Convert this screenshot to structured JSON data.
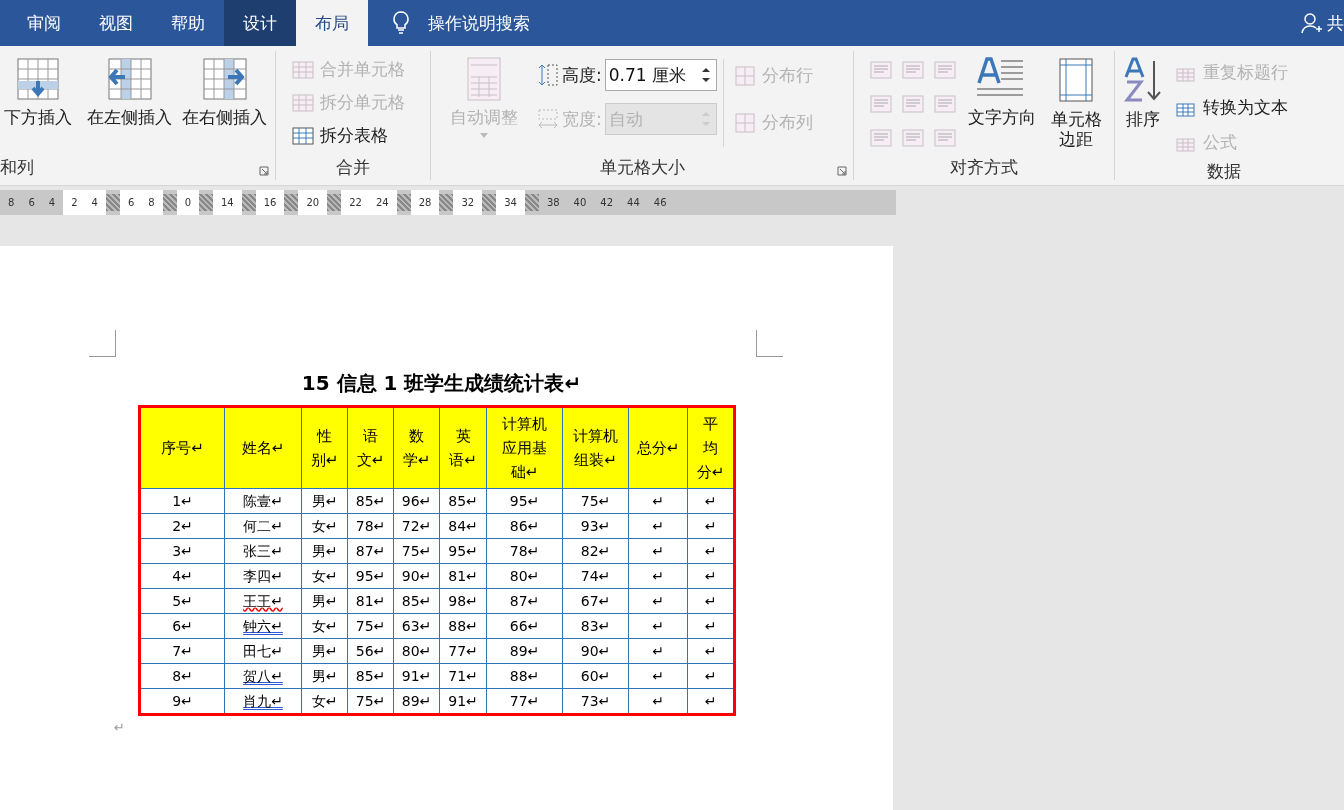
{
  "tabs": [
    {
      "label": "审阅",
      "selected": false,
      "contextual": false
    },
    {
      "label": "视图",
      "selected": false,
      "contextual": false
    },
    {
      "label": "帮助",
      "selected": false,
      "contextual": false
    },
    {
      "label": "设计",
      "selected": false,
      "contextual": true
    },
    {
      "label": "布局",
      "selected": true,
      "contextual": true
    }
  ],
  "search": {
    "label": "操作说明搜索"
  },
  "share": {
    "label": "共"
  },
  "ribbon": {
    "groups": [
      {
        "label": "和列",
        "items": [
          {
            "label": "下方插入",
            "disabled": false
          },
          {
            "label": "在左侧插入",
            "disabled": false
          },
          {
            "label": "在右侧插入",
            "disabled": false
          }
        ]
      },
      {
        "label": "合并",
        "items": [
          {
            "label": "合并单元格",
            "disabled": true
          },
          {
            "label": "拆分单元格",
            "disabled": true
          },
          {
            "label": "拆分表格",
            "disabled": false
          }
        ]
      },
      {
        "label": "单元格大小",
        "items": [
          {
            "label": "自动调整",
            "disabled": true
          },
          {
            "label": "高度:",
            "value": "0.71 厘米",
            "disabled": false
          },
          {
            "label": "宽度:",
            "value": "自动",
            "disabled": true
          },
          {
            "label": "分布行",
            "disabled": true
          },
          {
            "label": "分布列",
            "disabled": true
          }
        ]
      },
      {
        "label": "对齐方式",
        "items": [
          {
            "label": "文字方向",
            "disabled": false
          },
          {
            "label": "单元格边距",
            "disabled": false
          }
        ]
      },
      {
        "label": "数据",
        "items": [
          {
            "label": "排序",
            "disabled": false
          },
          {
            "label": "重复标题行",
            "disabled": true
          },
          {
            "label": "转换为文本",
            "disabled": false
          },
          {
            "label": "公式",
            "disabled": true
          }
        ]
      }
    ]
  },
  "ruler": [
    {
      "kind": "plain",
      "labels": [
        "8",
        "6",
        "4"
      ]
    },
    {
      "kind": "cell",
      "labels": [
        "2",
        "4"
      ]
    },
    {
      "kind": "marker"
    },
    {
      "kind": "cell",
      "labels": [
        "6",
        "8"
      ]
    },
    {
      "kind": "marker"
    },
    {
      "kind": "cell",
      "labels": [
        "0"
      ]
    },
    {
      "kind": "marker"
    },
    {
      "kind": "cell",
      "labels": [
        "14"
      ]
    },
    {
      "kind": "marker"
    },
    {
      "kind": "cell",
      "labels": [
        "16"
      ]
    },
    {
      "kind": "marker"
    },
    {
      "kind": "cell",
      "labels": [
        "20"
      ]
    },
    {
      "kind": "marker"
    },
    {
      "kind": "cell",
      "labels": [
        "22",
        "24"
      ]
    },
    {
      "kind": "marker"
    },
    {
      "kind": "cell",
      "labels": [
        "28"
      ]
    },
    {
      "kind": "marker"
    },
    {
      "kind": "cell",
      "labels": [
        "32"
      ]
    },
    {
      "kind": "marker"
    },
    {
      "kind": "cell",
      "labels": [
        "34"
      ]
    },
    {
      "kind": "marker"
    },
    {
      "kind": "plain",
      "labels": [
        "38",
        "40",
        "42",
        "44",
        "46"
      ]
    }
  ],
  "document": {
    "title": "15 信息 1 班学生成绩统计表↵",
    "table": {
      "columns": [
        "序号↵",
        "姓名↵",
        "性别↵",
        "语文↵",
        "数学↵",
        "英语↵",
        "计算机应用基础↵",
        "计算机组装↵",
        "总分↵",
        "平均分↵"
      ],
      "rows": [
        {
          "cells": [
            "1↵",
            "陈壹↵",
            "男↵",
            "85↵",
            "96↵",
            "85↵",
            "95↵",
            "75↵",
            "↵",
            "↵"
          ],
          "spelling_error": false,
          "grammar_error": false
        },
        {
          "cells": [
            "2↵",
            "何二↵",
            "女↵",
            "78↵",
            "72↵",
            "84↵",
            "86↵",
            "93↵",
            "↵",
            "↵"
          ],
          "spelling_error": false,
          "grammar_error": false
        },
        {
          "cells": [
            "3↵",
            "张三↵",
            "男↵",
            "87↵",
            "75↵",
            "95↵",
            "78↵",
            "82↵",
            "↵",
            "↵"
          ],
          "spelling_error": false,
          "grammar_error": false
        },
        {
          "cells": [
            "4↵",
            "李四↵",
            "女↵",
            "95↵",
            "90↵",
            "81↵",
            "80↵",
            "74↵",
            "↵",
            "↵"
          ],
          "spelling_error": false,
          "grammar_error": false
        },
        {
          "cells": [
            "5↵",
            "王王↵",
            "男↵",
            "81↵",
            "85↵",
            "98↵",
            "87↵",
            "67↵",
            "↵",
            "↵"
          ],
          "spelling_error": true,
          "grammar_error": false
        },
        {
          "cells": [
            "6↵",
            "钟六↵",
            "女↵",
            "75↵",
            "63↵",
            "88↵",
            "66↵",
            "83↵",
            "↵",
            "↵"
          ],
          "spelling_error": false,
          "grammar_error": true
        },
        {
          "cells": [
            "7↵",
            "田七↵",
            "男↵",
            "56↵",
            "80↵",
            "77↵",
            "89↵",
            "90↵",
            "↵",
            "↵"
          ],
          "spelling_error": false,
          "grammar_error": false
        },
        {
          "cells": [
            "8↵",
            "贺八↵",
            "男↵",
            "85↵",
            "91↵",
            "71↵",
            "88↵",
            "60↵",
            "↵",
            "↵"
          ],
          "spelling_error": false,
          "grammar_error": true
        },
        {
          "cells": [
            "9↵",
            "肖九↵",
            "女↵",
            "75↵",
            "89↵",
            "91↵",
            "77↵",
            "73↵",
            "↵",
            "↵"
          ],
          "spelling_error": false,
          "grammar_error": true
        }
      ]
    },
    "after_mark": "↵"
  }
}
